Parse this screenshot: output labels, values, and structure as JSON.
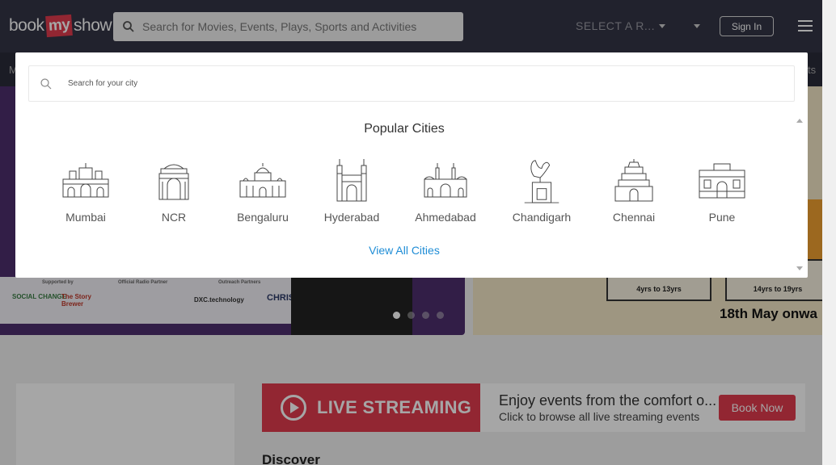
{
  "header": {
    "logo": {
      "left": "book",
      "mid": "my",
      "right": "show"
    },
    "search_placeholder": "Search for Movies, Events, Plays, Sports and Activities",
    "region_label": "SELECT A R...",
    "signin_label": "Sign In"
  },
  "subnav": {
    "left_text": "M",
    "right_text": "ts"
  },
  "banner": {
    "sponsors": [
      "SOCIAL CHANGE",
      "The Story Brewer",
      "DXC.technology",
      "CHRIST"
    ],
    "sponsor_captions": [
      "Supported by",
      "Official Radio Partner",
      "Outreach Partners"
    ],
    "age_boxes": [
      "4yrs to 13yrs",
      "14yrs to 19yrs"
    ],
    "date_text": "18th May onwa",
    "slide_count": 4,
    "active_slide": 1
  },
  "city_modal": {
    "search_placeholder": "Search for your city",
    "title": "Popular Cities",
    "cities": [
      {
        "name": "Mumbai",
        "icon": "mumbai-landmark-icon"
      },
      {
        "name": "NCR",
        "icon": "ncr-landmark-icon"
      },
      {
        "name": "Bengaluru",
        "icon": "bengaluru-landmark-icon"
      },
      {
        "name": "Hyderabad",
        "icon": "hyderabad-landmark-icon"
      },
      {
        "name": "Ahmedabad",
        "icon": "ahmedabad-landmark-icon"
      },
      {
        "name": "Chandigarh",
        "icon": "chandigarh-landmark-icon"
      },
      {
        "name": "Chennai",
        "icon": "chennai-landmark-icon"
      },
      {
        "name": "Pune",
        "icon": "pune-landmark-icon"
      }
    ],
    "view_all": "View All Cities"
  },
  "live": {
    "badge": "LIVE STREAMING",
    "line1": "Enjoy events from the comfort o...",
    "line2": "Click to browse all live streaming events",
    "button": "Book Now"
  },
  "discover_heading": "Discover",
  "colors": {
    "brand": "#e03b4d",
    "header_bg": "#333545",
    "link": "#1f8dd6"
  }
}
